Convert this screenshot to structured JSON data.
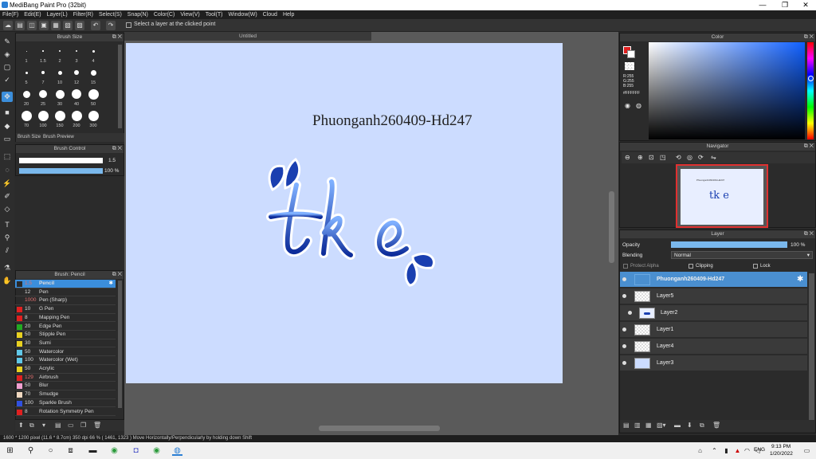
{
  "window": {
    "title": "MediBang Paint Pro (32bit)",
    "minimize": "—",
    "maximize": "❐",
    "close": "✕"
  },
  "menu": [
    "File(F)",
    "Edit(E)",
    "Layer(L)",
    "Filter(R)",
    "Select(S)",
    "Snap(N)",
    "Color(C)",
    "View(V)",
    "Tool(T)",
    "Window(W)",
    "Cloud",
    "Help"
  ],
  "toolbar": {
    "select_layer_label": "Select a layer at the clicked point"
  },
  "brush_size": {
    "title": "Brush Size",
    "sizes": [
      "1",
      "1.5",
      "2",
      "3",
      "4",
      "5",
      "7",
      "10",
      "12",
      "15",
      "20",
      "25",
      "30",
      "40",
      "50",
      "70",
      "100",
      "150",
      "200",
      "300"
    ],
    "tab1": "Brush Size",
    "tab2": "Brush Preview"
  },
  "brush_control": {
    "title": "Brush Control",
    "size_value": "1.5",
    "opacity_value": "100 %"
  },
  "brush_list": {
    "title": "Brush: Pencil",
    "items": [
      {
        "size": "1.5",
        "name": "Pencil",
        "color": "#2a2a2a"
      },
      {
        "size": "12",
        "name": "Pen",
        "color": "#2a2a2a"
      },
      {
        "size": "1000",
        "name": "Pen (Sharp)",
        "color": "#2a2a2a"
      },
      {
        "size": "10",
        "name": "G Pen",
        "color": "#e02020"
      },
      {
        "size": "8",
        "name": "Mapping Pen",
        "color": "#e02020"
      },
      {
        "size": "20",
        "name": "Edge Pen",
        "color": "#22aa22"
      },
      {
        "size": "50",
        "name": "Stipple Pen",
        "color": "#e8d020"
      },
      {
        "size": "30",
        "name": "Sumi",
        "color": "#e8d020"
      },
      {
        "size": "50",
        "name": "Watercolor",
        "color": "#60c8e8"
      },
      {
        "size": "100",
        "name": "Watercolor (Wet)",
        "color": "#60c8e8"
      },
      {
        "size": "50",
        "name": "Acrylic",
        "color": "#e8d020"
      },
      {
        "size": "129",
        "name": "Airbrush",
        "color": "#e02020"
      },
      {
        "size": "50",
        "name": "Blur",
        "color": "#f0a0d0"
      },
      {
        "size": "70",
        "name": "Smudge",
        "color": "#f0d8c0"
      },
      {
        "size": "100",
        "name": "Sparkle Brush",
        "color": "#3050e0"
      },
      {
        "size": "8",
        "name": "Rotation Symmetry Pen",
        "color": "#e02020"
      }
    ]
  },
  "canvas": {
    "tab_title": "Untitled",
    "watermark": "Phuonganh260409-Hd247",
    "letters": "tk e"
  },
  "color_panel": {
    "title": "Color",
    "r": "R:255",
    "g": "G:255",
    "b": "B:255",
    "hex": "#FFFFFF"
  },
  "navigator": {
    "title": "Navigator",
    "thumb_text": "Phuonganh260409-Hd247",
    "thumb_letters": "tk e"
  },
  "layer_panel": {
    "title": "Layer",
    "opacity_label": "Opacity",
    "opacity_value": "100 %",
    "blending_label": "Blending",
    "blending_value": "Normal",
    "protect_alpha": "Protect Alpha",
    "clipping": "Clipping",
    "lock": "Lock",
    "layers": [
      "Phuonganh260409-Hd247",
      "Layer5",
      "Layer2",
      "Layer1",
      "Layer4",
      "Layer3"
    ]
  },
  "status": {
    "text": "1600 * 1200 pixel   (11.6 * 8.7cm)   350 dpi   66 %   ( 1461, 1323 )   Move Horizontally/Perpendicularly by holding down Shift"
  },
  "taskbar": {
    "time": "9:13 PM",
    "date": "1/20/2022",
    "lang": "ENG"
  },
  "colors": {
    "accent": "#3b8edb",
    "canvas": "#ccdcff",
    "ink": "#1a3fb0"
  }
}
